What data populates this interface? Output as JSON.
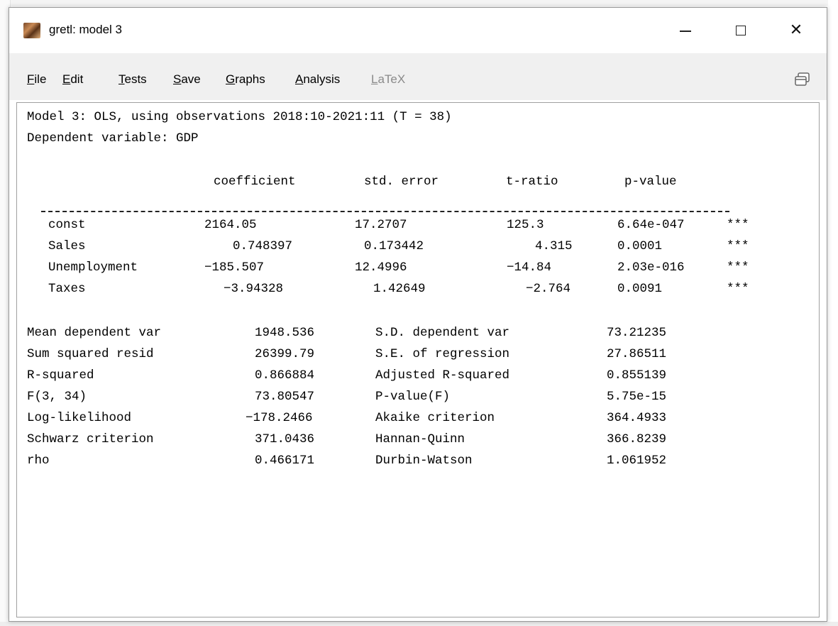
{
  "window": {
    "title": "gretl: model 3",
    "controls": {
      "minimize": "—",
      "maximize": "☐",
      "close": "✕"
    }
  },
  "menu": [
    {
      "label": "File",
      "accel": "F",
      "rest": "ile",
      "enabled": true
    },
    {
      "label": "Edit",
      "accel": "E",
      "rest": "dit",
      "enabled": true
    },
    {
      "label": "Tests",
      "accel": "T",
      "rest": "ests",
      "enabled": true
    },
    {
      "label": "Save",
      "accel": "S",
      "rest": "ave",
      "enabled": true
    },
    {
      "label": "Graphs",
      "accel": "G",
      "rest": "raphs",
      "enabled": true
    },
    {
      "label": "Analysis",
      "accel": "A",
      "rest": "nalysis",
      "enabled": true
    },
    {
      "label": "LaTeX",
      "accel": "L",
      "rest": "aTeX",
      "enabled": false
    }
  ],
  "output": {
    "header_line1": "Model 3: OLS, using observations 2018:10-2021:11 (T = 38)",
    "header_line2": "Dependent variable: GDP",
    "columns": [
      "coefficient",
      "std. error",
      "t-ratio",
      "p-value"
    ],
    "rows": [
      {
        "name": "const",
        "coef": "2164.05",
        "se": "17.2707",
        "t": "125.3",
        "p": "6.64e-047",
        "stars": "***"
      },
      {
        "name": "Sales",
        "coef": "0.748397",
        "se": "0.173442",
        "t": "4.315",
        "p": "0.0001",
        "stars": "***"
      },
      {
        "name": "Unemployment",
        "coef": "−185.507",
        "se": "12.4996",
        "t": "−14.84",
        "p": "2.03e-016",
        "stars": "***"
      },
      {
        "name": "Taxes",
        "coef": "−3.94328",
        "se": "1.42649",
        "t": "−2.764",
        "p": "0.0091",
        "stars": "***"
      }
    ],
    "stats": [
      {
        "l_label": "Mean dependent var",
        "l_value": "1948.536",
        "r_label": "S.D. dependent var",
        "r_value": "73.21235"
      },
      {
        "l_label": "Sum squared resid",
        "l_value": "26399.79",
        "r_label": "S.E. of regression",
        "r_value": "27.86511"
      },
      {
        "l_label": "R-squared",
        "l_value": "0.866884",
        "r_label": "Adjusted R-squared",
        "r_value": "0.855139"
      },
      {
        "l_label": "F(3, 34)",
        "l_value": "73.80547",
        "r_label": "P-value(F)",
        "r_value": "5.75e-15"
      },
      {
        "l_label": "Log-likelihood",
        "l_value": "−178.2466",
        "r_label": "Akaike criterion",
        "r_value": "364.4933"
      },
      {
        "l_label": "Schwarz criterion",
        "l_value": "371.0436",
        "r_label": "Hannan-Quinn",
        "r_value": "366.8239"
      },
      {
        "l_label": "rho",
        "l_value": "0.466171",
        "r_label": "Durbin-Watson",
        "r_value": "1.061952"
      }
    ]
  },
  "icons": {
    "app": "gretl-app-icon",
    "menu_right": "window-restore-icon"
  }
}
